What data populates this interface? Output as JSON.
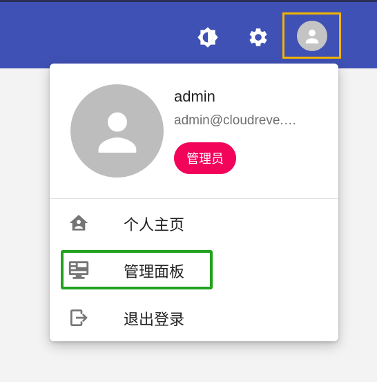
{
  "topbar": {
    "icons": [
      "brightness-icon",
      "settings-icon",
      "user-avatar-icon"
    ],
    "colors": {
      "bar": "#3f51b5",
      "avatar_highlight": "#f2b400"
    }
  },
  "profile": {
    "username": "admin",
    "email": "admin@cloudreve.…",
    "role": "管理员",
    "role_color": "#f2045b"
  },
  "menu": {
    "items": [
      {
        "icon": "home-account-icon",
        "label": "个人主页"
      },
      {
        "icon": "admin-panel-icon",
        "label": "管理面板"
      },
      {
        "icon": "logout-icon",
        "label": "退出登录"
      }
    ],
    "highlight_color": "#21a31f"
  }
}
